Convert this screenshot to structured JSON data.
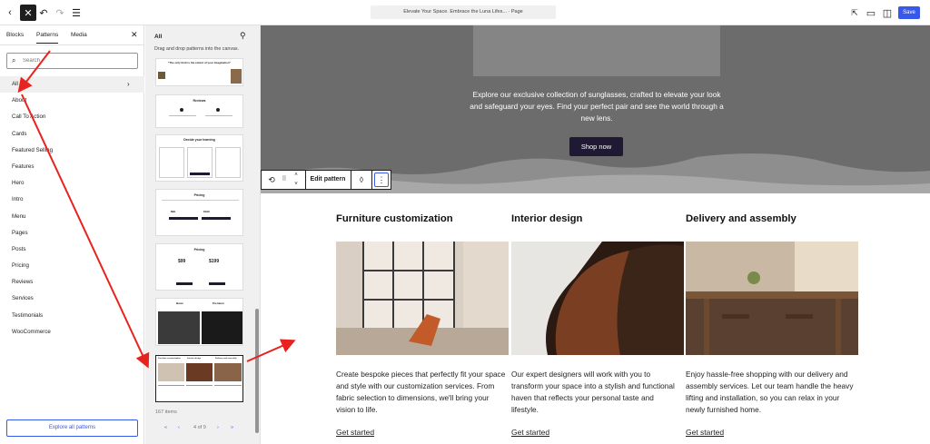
{
  "toolbar": {
    "document_title": "Elevate Your Space. Embrace the Luna Lifes... · Page",
    "save_label": "Save",
    "icons": [
      "back-icon",
      "close-icon",
      "undo-icon",
      "redo-icon",
      "list-view-icon",
      "external-link-icon",
      "desktop-preview-icon",
      "sidebar-toggle-icon"
    ]
  },
  "inserter": {
    "tabs": [
      {
        "label": "Blocks"
      },
      {
        "label": "Patterns"
      },
      {
        "label": "Media"
      }
    ],
    "active_tab": "Patterns",
    "search_placeholder": "Search",
    "categories": [
      {
        "label": "All"
      },
      {
        "label": "About"
      },
      {
        "label": "Call To Action"
      },
      {
        "label": "Cards"
      },
      {
        "label": "Featured Selling"
      },
      {
        "label": "Features"
      },
      {
        "label": "Hero"
      },
      {
        "label": "Intro"
      },
      {
        "label": "Menu"
      },
      {
        "label": "Pages"
      },
      {
        "label": "Posts"
      },
      {
        "label": "Pricing"
      },
      {
        "label": "Reviews"
      },
      {
        "label": "Services"
      },
      {
        "label": "Testimonials"
      },
      {
        "label": "WooCommerce"
      }
    ],
    "active_category": "All",
    "explore_label": "Explore all patterns"
  },
  "patterns_panel": {
    "title": "All",
    "subtitle": "Drag and drop patterns into the canvas.",
    "items_count": "167 items",
    "pager": {
      "first": "«",
      "prev": "‹",
      "page_text": "4 of 9",
      "next": "›",
      "last": "»"
    },
    "thumbs": [
      {
        "title": "\"The only limit is the extent of your imagination\""
      },
      {
        "title": "Reviews"
      },
      {
        "title": "Decide your learning"
      },
      {
        "title": "Pricing",
        "prices": [
          "$99",
          "$199"
        ]
      },
      {
        "title": "Pricing",
        "prices": [
          "$99",
          "$199"
        ]
      },
      {
        "title": "",
        "labels": [
          "Basic",
          "Premium"
        ]
      },
      {
        "title": "",
        "labels": [
          "Furniture customization",
          "Interior design",
          "Delivery and assembly"
        ]
      }
    ]
  },
  "canvas": {
    "hero": {
      "text": "Explore our exclusive collection of sunglasses, crafted to elevate your look and safeguard your eyes. Find your perfect pair and see the world through a new lens.",
      "button_label": "Shop now"
    },
    "block_toolbar": {
      "edit_label": "Edit pattern"
    },
    "columns": [
      {
        "heading": "Furniture customization",
        "body": "Create bespoke pieces that perfectly fit your space and style with our customization services. From fabric selection to dimensions, we'll bring your vision to life.",
        "link": "Get started"
      },
      {
        "heading": "Interior design",
        "body": "Our expert designers will work with you to transform your space into a stylish and functional haven that reflects your personal taste and lifestyle.",
        "link": "Get started"
      },
      {
        "heading": "Delivery and assembly",
        "body": "Enjoy hassle-free shopping with our delivery and assembly services. Let our team handle the heavy lifting and installation, so you can relax in your newly furnished home.",
        "link": "Get started"
      }
    ]
  },
  "colors": {
    "accent": "#3858e9",
    "annotation_arrow": "#e8231f",
    "shop_button": "#1f1933"
  }
}
